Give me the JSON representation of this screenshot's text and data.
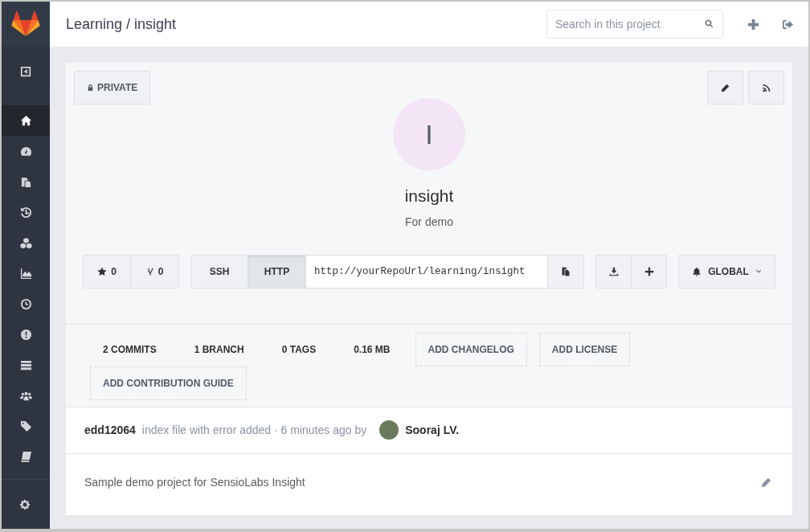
{
  "sidebar": {
    "items": [
      {
        "kind": "home",
        "selected": true
      },
      {
        "kind": "dashboard",
        "selected": false
      },
      {
        "kind": "files",
        "selected": false
      },
      {
        "kind": "history",
        "selected": false
      },
      {
        "kind": "cubes",
        "selected": false
      },
      {
        "kind": "graph",
        "selected": false
      },
      {
        "kind": "clock",
        "selected": false
      },
      {
        "kind": "issue",
        "selected": false
      },
      {
        "kind": "list",
        "selected": false
      },
      {
        "kind": "users",
        "selected": false
      },
      {
        "kind": "tag",
        "selected": false
      },
      {
        "kind": "book",
        "selected": false
      }
    ]
  },
  "header": {
    "title": "Learning / insight",
    "search": {
      "placeholder": "Search in this project"
    }
  },
  "project": {
    "visibility": "PRIVATE",
    "avatar_letter": "I",
    "name": "insight",
    "description": "For demo",
    "star_count": "0",
    "fork_count": "0",
    "clone": {
      "protocols": [
        {
          "label": "SSH",
          "selected": false
        },
        {
          "label": "HTTP",
          "selected": true
        }
      ],
      "url": "http://yourRepoUrl/learning/insight"
    },
    "notification": "GLOBAL"
  },
  "stats": [
    {
      "kind": "stat",
      "label": "2 COMMITS"
    },
    {
      "kind": "stat",
      "label": "1 BRANCH"
    },
    {
      "kind": "stat",
      "label": "0 TAGS"
    },
    {
      "kind": "stat",
      "label": "0.16 MB"
    },
    {
      "kind": "add",
      "label": "ADD CHANGELOG"
    },
    {
      "kind": "add",
      "label": "ADD LICENSE"
    },
    {
      "kind": "add",
      "label": "ADD CONTRIBUTION GUIDE"
    }
  ],
  "last_commit": {
    "sha": "edd12064",
    "message": "index file with error added · 6 minutes ago by",
    "author": "Sooraj LV."
  },
  "readme": "Sample demo project for SensioLabs Insight"
}
